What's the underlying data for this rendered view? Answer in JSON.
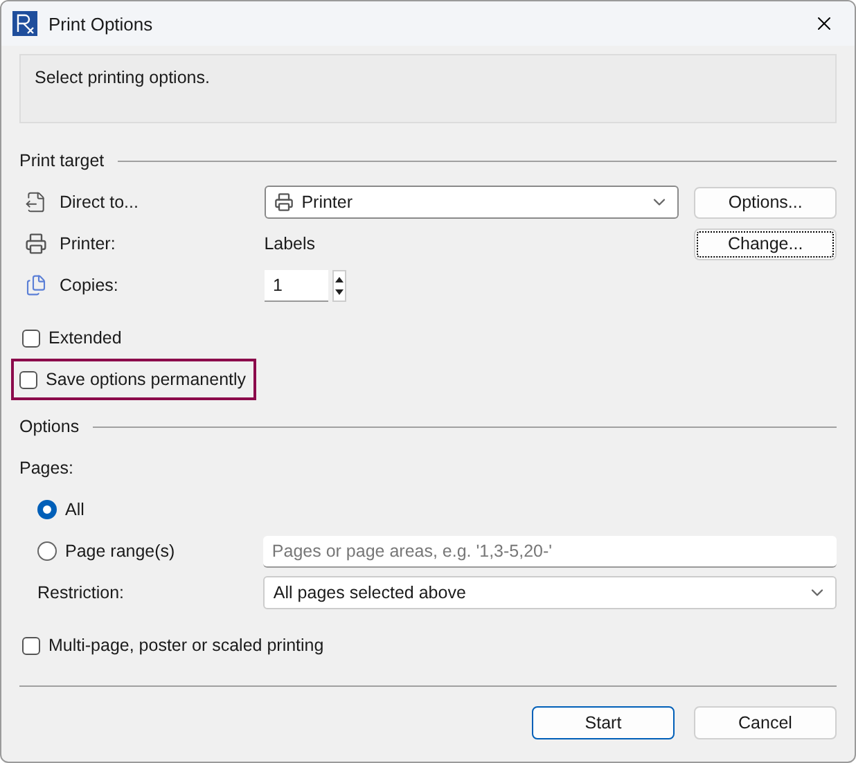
{
  "window": {
    "title": "Print Options"
  },
  "info": "Select printing options.",
  "print_target": {
    "heading": "Print target",
    "rows": [
      {
        "kind": "select",
        "label": "Direct to...",
        "value": "Printer",
        "button": "Options...",
        "focused": false
      },
      {
        "kind": "text",
        "label": "Printer:",
        "value": "Labels",
        "button": "Change...",
        "focused": true
      },
      {
        "kind": "spin",
        "label": "Copies:",
        "value": "1"
      }
    ]
  },
  "checkboxes": [
    {
      "label": "Extended",
      "checked": false,
      "highlighted": false
    },
    {
      "label": "Save options permanently",
      "checked": false,
      "highlighted": true
    }
  ],
  "options": {
    "heading": "Options",
    "pages_label": "Pages:",
    "radios": [
      {
        "label": "All",
        "selected": true
      },
      {
        "label": "Page range(s)",
        "selected": false,
        "placeholder": "Pages or page areas, e.g. '1,3-5,20-'"
      }
    ],
    "restriction": {
      "label": "Restriction:",
      "value": "All pages selected above"
    },
    "multi_page": {
      "label": "Multi-page, poster or scaled printing",
      "checked": false
    }
  },
  "buttons": [
    {
      "label": "Start",
      "default": true
    },
    {
      "label": "Cancel",
      "default": false
    }
  ]
}
